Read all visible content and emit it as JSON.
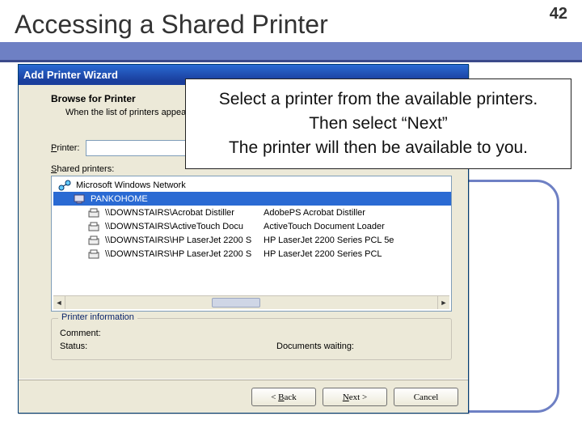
{
  "slide": {
    "title": "Accessing a Shared Printer",
    "number": "42"
  },
  "callout": {
    "line1": "Select a printer from the available printers.",
    "line2": "Then select “Next”",
    "line3": "The printer will then be available to you."
  },
  "wizard": {
    "title": "Add Printer Wizard",
    "browse_label": "Browse for Printer",
    "browse_sub": "When the list of printers appea",
    "printer_label": "Printer:",
    "printer_value": "",
    "shared_label": "Shared printers:",
    "tree": [
      {
        "icon": "net",
        "indent": 0,
        "text": "Microsoft Windows Network",
        "sel": false
      },
      {
        "icon": "host",
        "indent": 1,
        "text": "PANKOHOME",
        "sel": true
      },
      {
        "icon": "prn",
        "indent": 2,
        "text": "\\\\DOWNSTAIRS\\Acrobat Distiller",
        "desc": "AdobePS Acrobat Distiller"
      },
      {
        "icon": "prn",
        "indent": 2,
        "text": "\\\\DOWNSTAIRS\\ActiveTouch Docu",
        "desc": "ActiveTouch Document Loader"
      },
      {
        "icon": "prn",
        "indent": 2,
        "text": "\\\\DOWNSTAIRS\\HP LaserJet 2200 S",
        "desc": "HP LaserJet 2200 Series PCL 5e"
      },
      {
        "icon": "prn",
        "indent": 2,
        "text": "\\\\DOWNSTAIRS\\HP LaserJet 2200 S",
        "desc": "HP LaserJet 2200 Series PCL"
      }
    ],
    "info_title": "Printer information",
    "info_comment_k": "Comment:",
    "info_status_k": "Status:",
    "info_docs_k": "Documents waiting:",
    "btn_back": "< Back",
    "btn_next": "Next >",
    "btn_cancel": "Cancel"
  }
}
